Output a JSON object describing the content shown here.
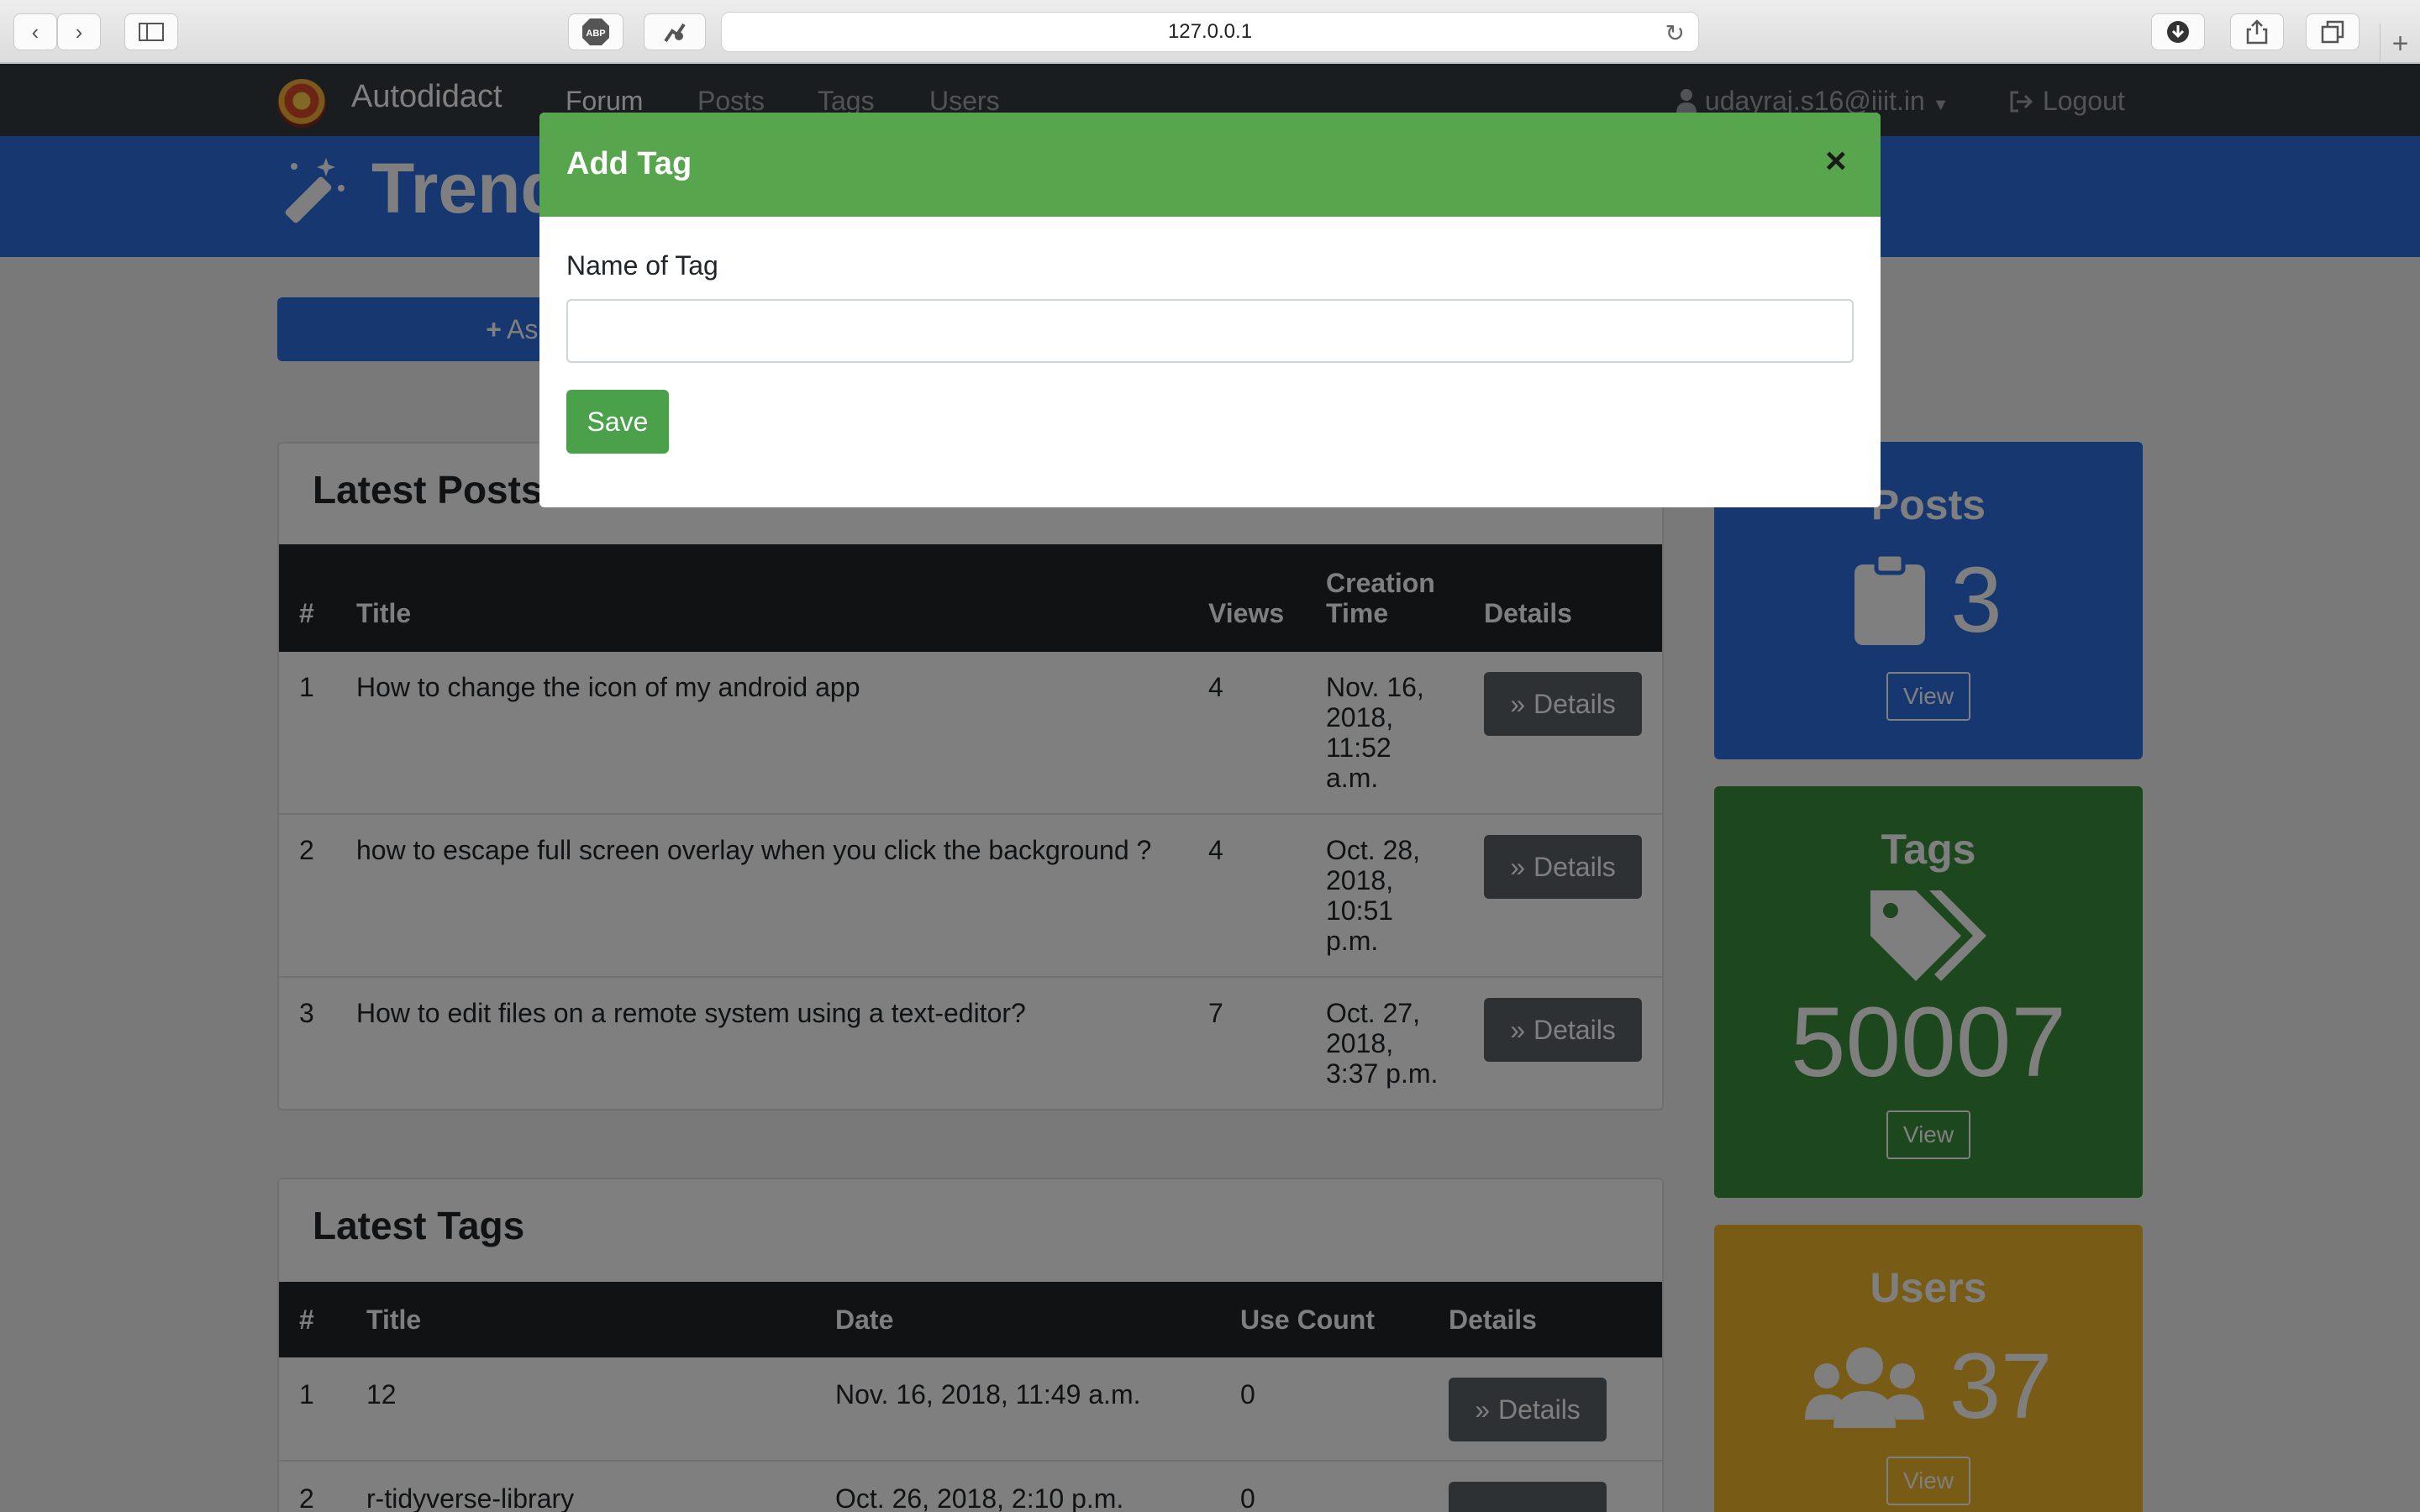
{
  "browser": {
    "url": "127.0.0.1",
    "adblock_label": "ABP"
  },
  "navbar": {
    "brand": "Autodidact",
    "links": [
      "Forum",
      "Posts",
      "Tags",
      "Users"
    ],
    "active": "Forum",
    "user": "udayraj.s16@iiit.in",
    "logout": "Logout"
  },
  "header": {
    "title": "Trend"
  },
  "ask_button": "Ask Ques",
  "latest_posts": {
    "title": "Latest Posts",
    "columns": {
      "num": "#",
      "title": "Title",
      "views": "Views",
      "time_line1": "Creation",
      "time_line2": "Time",
      "details": "Details"
    },
    "rows": [
      {
        "num": "1",
        "title": "How to change the icon of my android app",
        "views": "4",
        "time": [
          "Nov. 16,",
          "2018,",
          "11:52",
          "a.m."
        ]
      },
      {
        "num": "2",
        "title": "how to escape full screen overlay when you click the background ?",
        "views": "4",
        "time": [
          "Oct. 28,",
          "2018,",
          "10:51",
          "p.m."
        ]
      },
      {
        "num": "3",
        "title": "How to edit files on a remote system using a text-editor?",
        "views": "7",
        "time": [
          "Oct. 27,",
          "2018,",
          "3:37 p.m.",
          ""
        ]
      }
    ],
    "details_label": "Details"
  },
  "latest_tags": {
    "title": "Latest Tags",
    "columns": {
      "num": "#",
      "title": "Title",
      "date": "Date",
      "use_count": "Use Count",
      "details": "Details"
    },
    "rows": [
      {
        "num": "1",
        "title": "12",
        "date": "Nov. 16, 2018, 11:49 a.m.",
        "use_count": "0"
      },
      {
        "num": "2",
        "title": "r-tidyverse-library",
        "date": "Oct. 26, 2018, 2:10 p.m.",
        "use_count": "0"
      }
    ],
    "details_label": "Details"
  },
  "stats": [
    {
      "label": "Posts",
      "value": "3",
      "icon": "clipboard-icon",
      "view": "View",
      "color": "#2e6fe0"
    },
    {
      "label": "Tags",
      "value": "50007",
      "icon": "tags-icon",
      "view": "View",
      "color": "#3a8f3a"
    },
    {
      "label": "Users",
      "value": "37",
      "icon": "users-icon",
      "view": "View",
      "color": "#f0b72a"
    }
  ],
  "modal": {
    "title": "Add Tag",
    "close": "×",
    "field_label": "Name of Tag",
    "field_value": "",
    "field_placeholder": "",
    "save": "Save"
  }
}
